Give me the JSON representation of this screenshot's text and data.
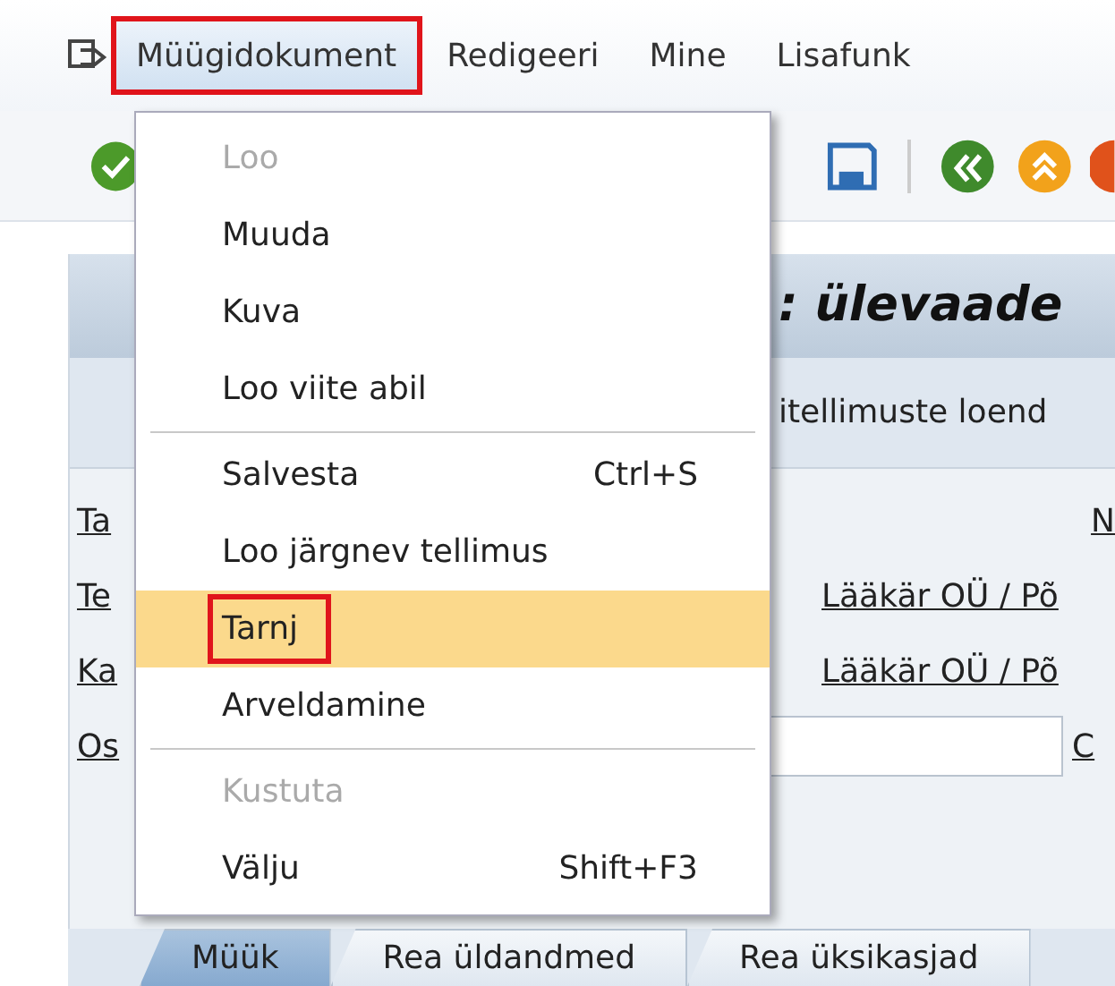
{
  "menu_bar": {
    "items": [
      {
        "label": "Müügidokument",
        "selected": true,
        "annotated": true
      },
      {
        "label": "Redigeeri",
        "selected": false,
        "annotated": false
      },
      {
        "label": "Mine",
        "selected": false,
        "annotated": false
      },
      {
        "label": "Lisafunk",
        "selected": false,
        "annotated": false
      }
    ]
  },
  "dropdown": {
    "groups": [
      [
        {
          "label": "Loo",
          "disabled": true,
          "selected": false,
          "annotated": false
        },
        {
          "label": "Muuda",
          "disabled": false,
          "selected": false,
          "annotated": false
        },
        {
          "label": "Kuva",
          "disabled": false,
          "selected": false,
          "annotated": false
        },
        {
          "label": "Loo viite abil",
          "disabled": false,
          "selected": false,
          "annotated": false
        }
      ],
      [
        {
          "label": "Salvesta",
          "shortcut": "Ctrl+S",
          "disabled": false,
          "selected": false,
          "annotated": false
        },
        {
          "label": "Loo järgnev tellimus",
          "disabled": false,
          "selected": false,
          "annotated": false
        },
        {
          "label": "Tarnj",
          "disabled": false,
          "selected": true,
          "annotated": true
        },
        {
          "label": "Arveldamine",
          "disabled": false,
          "selected": false,
          "annotated": false
        }
      ],
      [
        {
          "label": "Kustuta",
          "disabled": true,
          "selected": false,
          "annotated": false
        },
        {
          "label": "Välju",
          "shortcut": "Shift+F3",
          "disabled": false,
          "selected": false,
          "annotated": false
        }
      ]
    ]
  },
  "title": ": ülevaade",
  "app_toolbar": {
    "button": "itellimuste loend"
  },
  "form": {
    "rows": [
      {
        "label": "Ta",
        "kind": "label",
        "right": "N"
      },
      {
        "label": "Te",
        "kind": "link",
        "right": "Lääkär OÜ / Põ"
      },
      {
        "label": "Ka",
        "kind": "link",
        "right": "Lääkär OÜ / Põ"
      },
      {
        "label": "Os",
        "kind": "field",
        "right": "C"
      }
    ]
  },
  "tabs": [
    {
      "label": "Müük",
      "selected": true
    },
    {
      "label": "Rea üldandmed",
      "selected": false
    },
    {
      "label": "Rea üksikasjad",
      "selected": false
    }
  ]
}
